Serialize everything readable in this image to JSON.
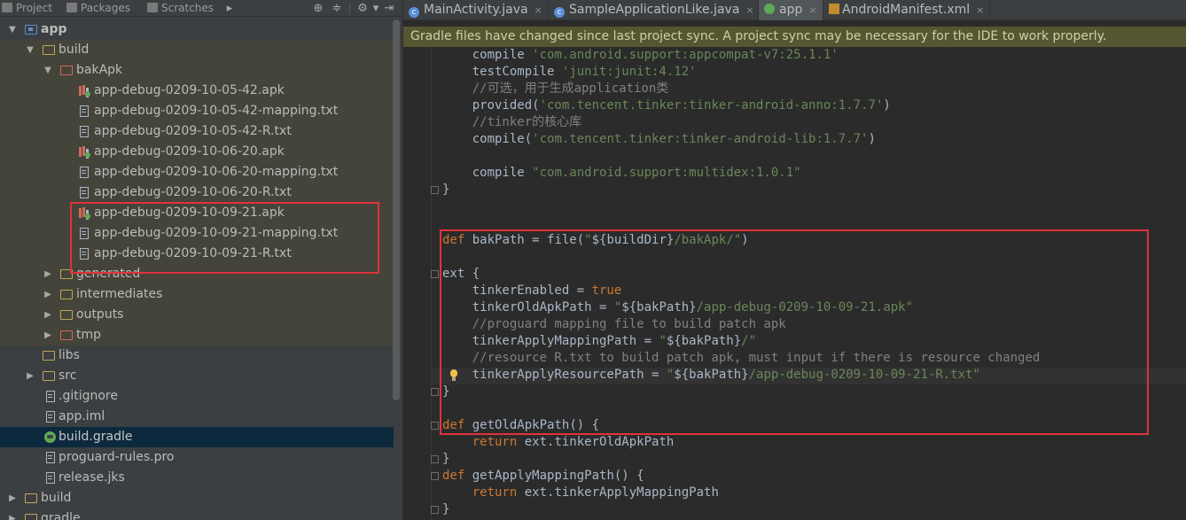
{
  "left_tabs": [
    {
      "label": "Project",
      "icon": "project-icon"
    },
    {
      "label": "Packages",
      "icon": "packages-icon"
    },
    {
      "label": "Scratches",
      "icon": "scratches-icon"
    }
  ],
  "tree": [
    {
      "label": "app"
    },
    {
      "label": "build"
    },
    {
      "label": "bakApk"
    },
    {
      "label": "app-debug-0209-10-05-42.apk"
    },
    {
      "label": "app-debug-0209-10-05-42-mapping.txt"
    },
    {
      "label": "app-debug-0209-10-05-42-R.txt"
    },
    {
      "label": "app-debug-0209-10-06-20.apk"
    },
    {
      "label": "app-debug-0209-10-06-20-mapping.txt"
    },
    {
      "label": "app-debug-0209-10-06-20-R.txt"
    },
    {
      "label": "app-debug-0209-10-09-21.apk"
    },
    {
      "label": "app-debug-0209-10-09-21-mapping.txt"
    },
    {
      "label": "app-debug-0209-10-09-21-R.txt"
    },
    {
      "label": "generated"
    },
    {
      "label": "intermediates"
    },
    {
      "label": "outputs"
    },
    {
      "label": "tmp"
    },
    {
      "label": "libs"
    },
    {
      "label": "src"
    },
    {
      "label": ".gitignore"
    },
    {
      "label": "app.iml"
    },
    {
      "label": "build.gradle"
    },
    {
      "label": "proguard-rules.pro"
    },
    {
      "label": "release.jks"
    },
    {
      "label": "build"
    },
    {
      "label": "gradle"
    }
  ],
  "editor_tabs": [
    {
      "label": "MainActivity.java",
      "icon": "java-class-icon"
    },
    {
      "label": "SampleApplicationLike.java",
      "icon": "java-class-icon"
    },
    {
      "label": "app",
      "icon": "gradle-icon"
    },
    {
      "label": "AndroidManifest.xml",
      "icon": "manifest-icon"
    }
  ],
  "banner": "Gradle files have changed since last project sync. A project sync may be necessary for the IDE to work properly.",
  "code": {
    "l1a": "    compile ",
    "l1b": "'com.android.support:appcompat-v7:25.1.1'",
    "l2a": "    testCompile ",
    "l2b": "'junit:junit:4.12'",
    "l3": "    //可选，用于生成application类",
    "l4a": "    provided(",
    "l4b": "'com.tencent.tinker:tinker-android-anno:1.7.7'",
    "l4c": ")",
    "l5": "    //tinker的核心库",
    "l6a": "    compile(",
    "l6b": "'com.tencent.tinker:tinker-android-lib:1.7.7'",
    "l6c": ")",
    "l8a": "    compile ",
    "l8b": "\"com.android.support:multidex:1.0.1\"",
    "l9": "}",
    "l12a": "def",
    "l12b": " bakPath = file(",
    "l12c": "\"",
    "l12d": "${buildDir}",
    "l12e": "/bakApk/\"",
    "l12f": ")",
    "l14": "ext {",
    "l15a": "    tinkerEnabled = ",
    "l15b": "true",
    "l16a": "    tinkerOldApkPath = ",
    "l16b": "\"",
    "l16c": "${bakPath}",
    "l16d": "/app-debug-0209-10-09-21.apk\"",
    "l17": "    //proguard mapping file to build patch apk",
    "l18a": "    tinkerApplyMappingPath = ",
    "l18b": "\"",
    "l18c": "${bakPath}",
    "l18d": "/\"",
    "l19": "    //resource R.txt to build patch apk, must input if there is resource changed",
    "l20a": "    tinkerApplyResourcePath = ",
    "l20b": "\"",
    "l20c": "${bakPath}",
    "l20d": "/app-debug-0209-10-09-21-R.txt\"",
    "l21": "}",
    "l23a": "def",
    "l23b": " getOldApkPath",
    "l23c": "() {",
    "l24a": "    return",
    "l24b": " ext.tinkerOldApkPath",
    "l25": "}",
    "l26a": "def",
    "l26b": " getApplyMappingPath",
    "l26c": "() {",
    "l27a": "    return",
    "l27b": " ext.tinkerApplyMappingPath",
    "l28": "}"
  }
}
